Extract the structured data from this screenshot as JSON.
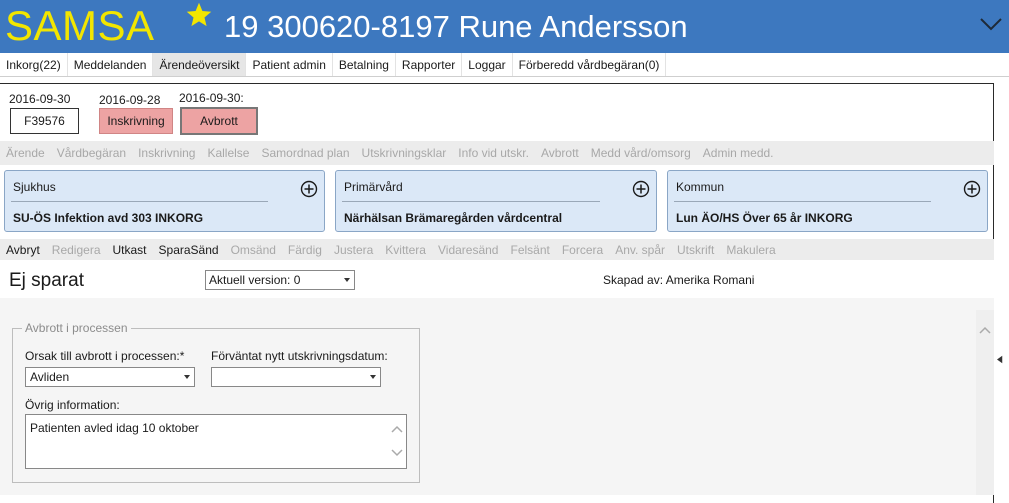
{
  "app": {
    "logo": "SAMSA",
    "patient": "19 300620-8197 Rune Andersson"
  },
  "menu": [
    {
      "label": "Inkorg(22)",
      "active": false
    },
    {
      "label": "Meddelanden",
      "active": false
    },
    {
      "label": "Ärendeöversikt",
      "active": true
    },
    {
      "label": "Patient admin",
      "active": false
    },
    {
      "label": "Betalning",
      "active": false
    },
    {
      "label": "Rapporter",
      "active": false
    },
    {
      "label": "Loggar",
      "active": false
    },
    {
      "label": "Förberedd vårdbegäran(0)",
      "active": false
    }
  ],
  "timeline": {
    "date1": "2016-09-30",
    "case_id": "F39576",
    "date2": "2016-09-28",
    "step1": "Inskrivning",
    "date3": "2016-09-30:",
    "step2": "Avbrott"
  },
  "process_tabs": [
    {
      "label": "Ärende",
      "enabled": false
    },
    {
      "label": "Vårdbegäran",
      "enabled": false
    },
    {
      "label": "Inskrivning",
      "enabled": false
    },
    {
      "label": "Kallelse",
      "enabled": false
    },
    {
      "label": "Samordnad plan",
      "enabled": false
    },
    {
      "label": "Utskrivningsklar",
      "enabled": false
    },
    {
      "label": "Info vid utskr.",
      "enabled": false
    },
    {
      "label": "Avbrott",
      "enabled": false
    },
    {
      "label": "Medd vård/omsorg",
      "enabled": false
    },
    {
      "label": "Admin medd.",
      "enabled": false
    }
  ],
  "cards": [
    {
      "title": "Sjukhus",
      "unit": "SU-ÖS Infektion avd 303 INKORG"
    },
    {
      "title": "Primärvård",
      "unit": "Närhälsan Brämaregården vårdcentral"
    },
    {
      "title": "Kommun",
      "unit": "Lun ÄO/HS Över 65 år INKORG"
    }
  ],
  "actions": [
    {
      "label": "Avbryt",
      "enabled": true
    },
    {
      "label": "Redigera",
      "enabled": false
    },
    {
      "label": "Utkast",
      "enabled": true
    },
    {
      "label": "SparaSänd",
      "enabled": true
    },
    {
      "label": "Omsänd",
      "enabled": false
    },
    {
      "label": "Färdig",
      "enabled": false
    },
    {
      "label": "Justera",
      "enabled": false
    },
    {
      "label": "Kvittera",
      "enabled": false
    },
    {
      "label": "Vidaresänd",
      "enabled": false
    },
    {
      "label": "Felsänt",
      "enabled": false
    },
    {
      "label": "Forcera",
      "enabled": false
    },
    {
      "label": "Anv. spår",
      "enabled": false
    },
    {
      "label": "Utskrift",
      "enabled": false
    },
    {
      "label": "Makulera",
      "enabled": false
    }
  ],
  "form": {
    "status": "Ej sparat",
    "version": "Aktuell version: 0",
    "created_by": "Skapad av: Amerika Romani",
    "group_title": "Avbrott i processen",
    "reason_label": "Orsak till avbrott i processen:*",
    "reason_value": "Avliden",
    "date_label": "Förväntat nytt utskrivningsdatum:",
    "date_value": "",
    "info_label": "Övrig information:",
    "info_value": "Patienten avled idag 10 oktober"
  },
  "colors": {
    "header": "#3d78bf",
    "logo": "#f2e600",
    "card": "#dbe8f7",
    "timeline_step": "#eda3a3"
  },
  "icons": [
    "star-icon",
    "chevron-down-icon",
    "plus-circle-icon",
    "dropdown-caret-icon",
    "scroll-up-icon",
    "scroll-down-icon",
    "collapse-arrow-icon"
  ]
}
